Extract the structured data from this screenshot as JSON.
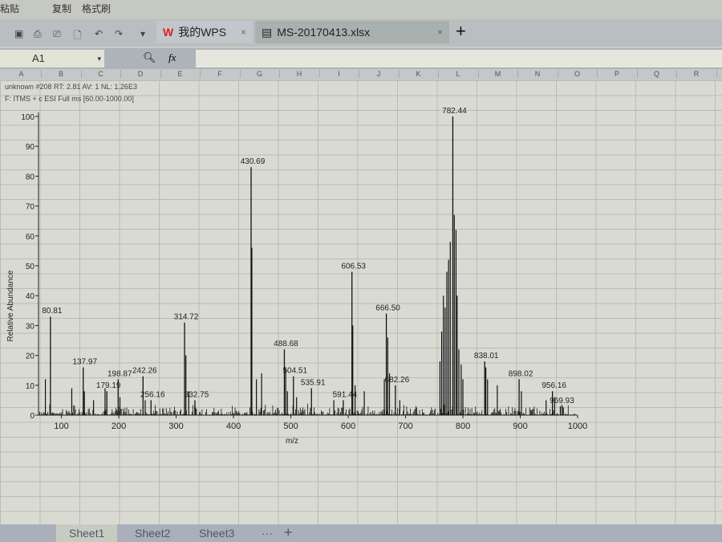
{
  "app": {
    "tabs": [
      {
        "label": "我的WPS"
      },
      {
        "label": "MS-20170413.xlsx"
      }
    ],
    "new_tab": "+",
    "ribbon": [
      "粘贴",
      "复制",
      "格式刷"
    ]
  },
  "formula_bar": {
    "cell_ref": "A1",
    "fx": "fx",
    "value": ""
  },
  "columns": [
    "A",
    "B",
    "C",
    "D",
    "E",
    "F",
    "G",
    "H",
    "I",
    "J",
    "K",
    "L",
    "M",
    "N",
    "O",
    "P",
    "Q",
    "R"
  ],
  "sheets": [
    "Sheet1",
    "Sheet2",
    "Sheet3"
  ],
  "sheet_more": "···",
  "sheet_add": "+",
  "chart_data": {
    "type": "bar",
    "header_line1": "unknown #208  RT: 2.81  AV: 1  NL: 1.26E3",
    "header_line2": "F: ITMS + c ESI Full ms [60.00-1000.00]",
    "xlabel": "m/z",
    "ylabel": "Relative Abundance",
    "xlim": [
      60,
      1000
    ],
    "ylim": [
      0,
      100
    ],
    "xticks": [
      100,
      200,
      300,
      400,
      500,
      600,
      700,
      800,
      900,
      1000
    ],
    "yticks": [
      0,
      10,
      20,
      30,
      40,
      50,
      60,
      70,
      80,
      90,
      100
    ],
    "labeled_peaks": [
      {
        "mz": 80.81,
        "label": "80.81",
        "rel": 33
      },
      {
        "mz": 137.97,
        "label": "137.97",
        "rel": 16
      },
      {
        "mz": 179.19,
        "label": "179.19",
        "rel": 8
      },
      {
        "mz": 198.87,
        "label": "198.87",
        "rel": 12
      },
      {
        "mz": 242.26,
        "label": "242.26",
        "rel": 13
      },
      {
        "mz": 256.16,
        "label": "256.16",
        "rel": 5
      },
      {
        "mz": 314.72,
        "label": "314.72",
        "rel": 31
      },
      {
        "mz": 332.75,
        "label": "332.75",
        "rel": 5
      },
      {
        "mz": 430.69,
        "label": "430.69",
        "rel": 83
      },
      {
        "mz": 488.68,
        "label": "488.68",
        "rel": 22
      },
      {
        "mz": 504.51,
        "label": "504.51",
        "rel": 13
      },
      {
        "mz": 535.91,
        "label": "535.91",
        "rel": 9
      },
      {
        "mz": 591.44,
        "label": "591.44",
        "rel": 5
      },
      {
        "mz": 606.53,
        "label": "606.53",
        "rel": 48
      },
      {
        "mz": 666.5,
        "label": "666.50",
        "rel": 34
      },
      {
        "mz": 682.26,
        "label": "682.26",
        "rel": 10
      },
      {
        "mz": 782.44,
        "label": "782.44",
        "rel": 100
      },
      {
        "mz": 838.01,
        "label": "838.01",
        "rel": 18
      },
      {
        "mz": 898.02,
        "label": "898.02",
        "rel": 12
      },
      {
        "mz": 956.16,
        "label": "956.16",
        "rel": 8
      },
      {
        "mz": 969.93,
        "label": "969.93",
        "rel": 3
      }
    ],
    "other_peaks": [
      [
        72,
        12
      ],
      [
        118,
        9
      ],
      [
        140,
        8
      ],
      [
        156,
        5
      ],
      [
        176,
        9
      ],
      [
        202,
        6
      ],
      [
        246,
        5
      ],
      [
        317,
        20
      ],
      [
        322,
        8
      ],
      [
        432,
        56
      ],
      [
        440,
        12
      ],
      [
        449,
        14
      ],
      [
        491,
        16
      ],
      [
        494,
        8
      ],
      [
        510,
        6
      ],
      [
        575,
        5
      ],
      [
        608,
        30
      ],
      [
        612,
        10
      ],
      [
        628,
        8
      ],
      [
        663,
        12
      ],
      [
        669,
        26
      ],
      [
        672,
        14
      ],
      [
        690,
        5
      ],
      [
        760,
        18
      ],
      [
        763,
        28
      ],
      [
        766,
        40
      ],
      [
        769,
        36
      ],
      [
        772,
        48
      ],
      [
        775,
        52
      ],
      [
        778,
        58
      ],
      [
        785,
        67
      ],
      [
        788,
        62
      ],
      [
        790,
        40
      ],
      [
        793,
        22
      ],
      [
        797,
        17
      ],
      [
        800,
        12
      ],
      [
        840,
        16
      ],
      [
        843,
        12
      ],
      [
        860,
        10
      ],
      [
        902,
        8
      ],
      [
        945,
        5
      ],
      [
        960,
        6
      ]
    ]
  }
}
